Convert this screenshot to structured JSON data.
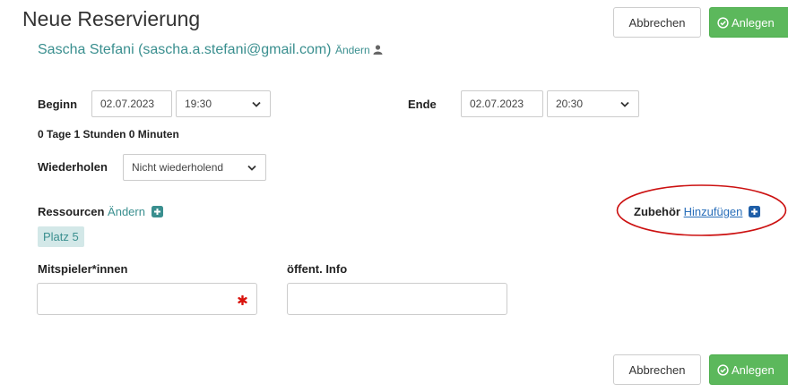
{
  "header": {
    "title": "Neue Reservierung",
    "user_text": "Sascha Stefani (sascha.a.stefani@gmail.com)",
    "user_change_label": "Ändern"
  },
  "top_actions": {
    "cancel_label": "Abbrechen",
    "create_label": "Anlegen"
  },
  "begin": {
    "label": "Beginn",
    "date": "02.07.2023",
    "time": "19:30"
  },
  "end": {
    "label": "Ende",
    "date": "02.07.2023",
    "time": "20:30"
  },
  "duration_text": "0 Tage 1 Stunden 0 Minuten",
  "repeat": {
    "label": "Wiederholen",
    "value": "Nicht wiederholend"
  },
  "resources": {
    "label": "Ressourcen",
    "change_label": "Ändern",
    "items": [
      "Platz 5"
    ]
  },
  "accessories": {
    "label": "Zubehör",
    "add_label": "Hinzufügen"
  },
  "participants": {
    "label": "Mitspieler*innen",
    "value": ""
  },
  "public_info": {
    "label": "öffent. Info",
    "value": ""
  },
  "bottom_actions": {
    "cancel_label": "Abbrechen",
    "create_label": "Anlegen"
  },
  "colors": {
    "accent_teal": "#3a8f8f",
    "success_green": "#5cb85c",
    "link_blue": "#2a6fba",
    "required_red": "#d9140d",
    "annotation_red": "#cc1111"
  }
}
